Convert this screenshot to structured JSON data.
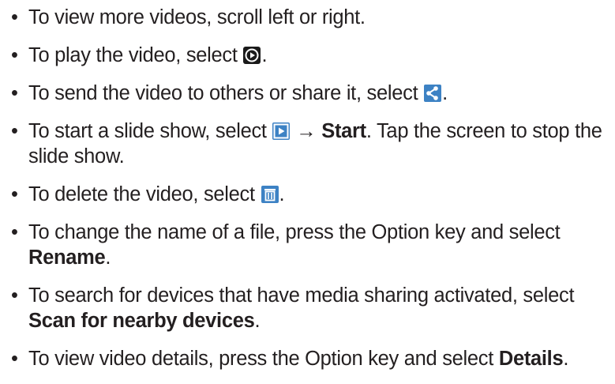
{
  "bullet_char": "•",
  "items": [
    {
      "text": "To view more videos, scroll left or right."
    },
    {
      "pre": "To play the video, select ",
      "icon": "play-circle-icon",
      "post": "."
    },
    {
      "pre": "To send the video to others or share it, select ",
      "icon": "share-icon",
      "post": "."
    },
    {
      "pre": "To start a slide show, select ",
      "icon": "slideshow-icon",
      "arrow": " → ",
      "bold": "Start",
      "post": ". Tap the screen to stop the slide show."
    },
    {
      "pre": "To delete the video, select ",
      "icon": "trash-icon",
      "post": "."
    },
    {
      "pre": "To change the name of a file, press the Option key and select ",
      "bold": "Rename",
      "post": "."
    },
    {
      "pre": "To search for devices that have media sharing activated, select ",
      "bold": "Scan for nearby devices",
      "post": "."
    },
    {
      "pre": "To view video details, press the Option key and select ",
      "bold": "Details",
      "post": "."
    }
  ],
  "colors": {
    "text": "#231f20",
    "icon_dark": "#1a1a1a",
    "icon_blue": "#3d82c4"
  }
}
